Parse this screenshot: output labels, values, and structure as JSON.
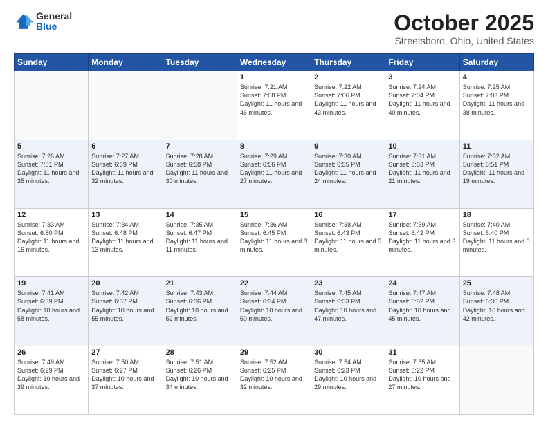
{
  "logo": {
    "general": "General",
    "blue": "Blue"
  },
  "title": "October 2025",
  "subtitle": "Streetsboro, Ohio, United States",
  "days_of_week": [
    "Sunday",
    "Monday",
    "Tuesday",
    "Wednesday",
    "Thursday",
    "Friday",
    "Saturday"
  ],
  "weeks": [
    [
      {
        "day": "",
        "info": ""
      },
      {
        "day": "",
        "info": ""
      },
      {
        "day": "",
        "info": ""
      },
      {
        "day": "1",
        "info": "Sunrise: 7:21 AM\nSunset: 7:08 PM\nDaylight: 11 hours and 46 minutes."
      },
      {
        "day": "2",
        "info": "Sunrise: 7:22 AM\nSunset: 7:06 PM\nDaylight: 11 hours and 43 minutes."
      },
      {
        "day": "3",
        "info": "Sunrise: 7:24 AM\nSunset: 7:04 PM\nDaylight: 11 hours and 40 minutes."
      },
      {
        "day": "4",
        "info": "Sunrise: 7:25 AM\nSunset: 7:03 PM\nDaylight: 11 hours and 38 minutes."
      }
    ],
    [
      {
        "day": "5",
        "info": "Sunrise: 7:26 AM\nSunset: 7:01 PM\nDaylight: 11 hours and 35 minutes."
      },
      {
        "day": "6",
        "info": "Sunrise: 7:27 AM\nSunset: 6:59 PM\nDaylight: 11 hours and 32 minutes."
      },
      {
        "day": "7",
        "info": "Sunrise: 7:28 AM\nSunset: 6:58 PM\nDaylight: 11 hours and 30 minutes."
      },
      {
        "day": "8",
        "info": "Sunrise: 7:29 AM\nSunset: 6:56 PM\nDaylight: 11 hours and 27 minutes."
      },
      {
        "day": "9",
        "info": "Sunrise: 7:30 AM\nSunset: 6:55 PM\nDaylight: 11 hours and 24 minutes."
      },
      {
        "day": "10",
        "info": "Sunrise: 7:31 AM\nSunset: 6:53 PM\nDaylight: 11 hours and 21 minutes."
      },
      {
        "day": "11",
        "info": "Sunrise: 7:32 AM\nSunset: 6:51 PM\nDaylight: 11 hours and 19 minutes."
      }
    ],
    [
      {
        "day": "12",
        "info": "Sunrise: 7:33 AM\nSunset: 6:50 PM\nDaylight: 11 hours and 16 minutes."
      },
      {
        "day": "13",
        "info": "Sunrise: 7:34 AM\nSunset: 6:48 PM\nDaylight: 11 hours and 13 minutes."
      },
      {
        "day": "14",
        "info": "Sunrise: 7:35 AM\nSunset: 6:47 PM\nDaylight: 11 hours and 11 minutes."
      },
      {
        "day": "15",
        "info": "Sunrise: 7:36 AM\nSunset: 6:45 PM\nDaylight: 11 hours and 8 minutes."
      },
      {
        "day": "16",
        "info": "Sunrise: 7:38 AM\nSunset: 6:43 PM\nDaylight: 11 hours and 5 minutes."
      },
      {
        "day": "17",
        "info": "Sunrise: 7:39 AM\nSunset: 6:42 PM\nDaylight: 11 hours and 3 minutes."
      },
      {
        "day": "18",
        "info": "Sunrise: 7:40 AM\nSunset: 6:40 PM\nDaylight: 11 hours and 0 minutes."
      }
    ],
    [
      {
        "day": "19",
        "info": "Sunrise: 7:41 AM\nSunset: 6:39 PM\nDaylight: 10 hours and 58 minutes."
      },
      {
        "day": "20",
        "info": "Sunrise: 7:42 AM\nSunset: 6:37 PM\nDaylight: 10 hours and 55 minutes."
      },
      {
        "day": "21",
        "info": "Sunrise: 7:43 AM\nSunset: 6:36 PM\nDaylight: 10 hours and 52 minutes."
      },
      {
        "day": "22",
        "info": "Sunrise: 7:44 AM\nSunset: 6:34 PM\nDaylight: 10 hours and 50 minutes."
      },
      {
        "day": "23",
        "info": "Sunrise: 7:45 AM\nSunset: 6:33 PM\nDaylight: 10 hours and 47 minutes."
      },
      {
        "day": "24",
        "info": "Sunrise: 7:47 AM\nSunset: 6:32 PM\nDaylight: 10 hours and 45 minutes."
      },
      {
        "day": "25",
        "info": "Sunrise: 7:48 AM\nSunset: 6:30 PM\nDaylight: 10 hours and 42 minutes."
      }
    ],
    [
      {
        "day": "26",
        "info": "Sunrise: 7:49 AM\nSunset: 6:29 PM\nDaylight: 10 hours and 39 minutes."
      },
      {
        "day": "27",
        "info": "Sunrise: 7:50 AM\nSunset: 6:27 PM\nDaylight: 10 hours and 37 minutes."
      },
      {
        "day": "28",
        "info": "Sunrise: 7:51 AM\nSunset: 6:26 PM\nDaylight: 10 hours and 34 minutes."
      },
      {
        "day": "29",
        "info": "Sunrise: 7:52 AM\nSunset: 6:25 PM\nDaylight: 10 hours and 32 minutes."
      },
      {
        "day": "30",
        "info": "Sunrise: 7:54 AM\nSunset: 6:23 PM\nDaylight: 10 hours and 29 minutes."
      },
      {
        "day": "31",
        "info": "Sunrise: 7:55 AM\nSunset: 6:22 PM\nDaylight: 10 hours and 27 minutes."
      },
      {
        "day": "",
        "info": ""
      }
    ]
  ]
}
